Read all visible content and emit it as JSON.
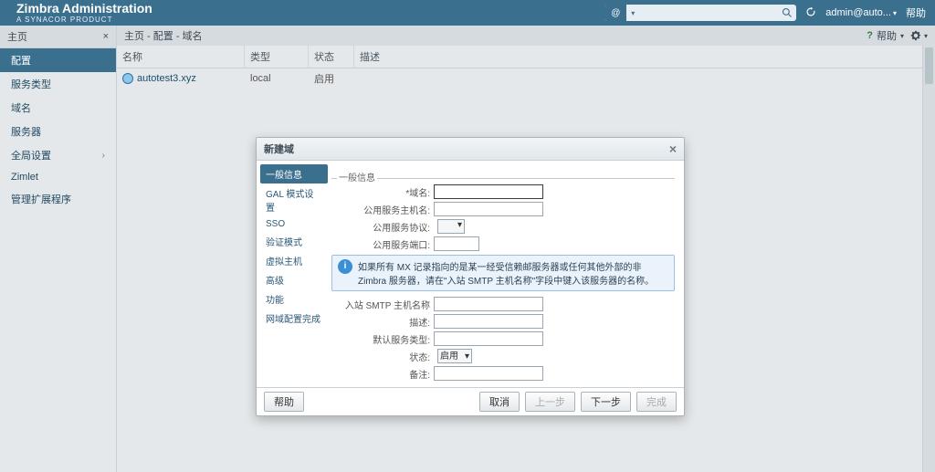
{
  "header": {
    "title": "Zimbra Administration",
    "subtitle": "A SYNACOR PRODUCT",
    "search_category_icon": "@",
    "search_placeholder": "",
    "user_label": "admin@auto...",
    "help_label": "帮助"
  },
  "left_nav": {
    "tab_title": "主页",
    "items": [
      {
        "label": "配置",
        "selected": true
      },
      {
        "label": "服务类型"
      },
      {
        "label": "域名"
      },
      {
        "label": "服务器"
      },
      {
        "label": "全局设置",
        "expandable": true
      },
      {
        "label": "Zimlet"
      },
      {
        "label": "管理扩展程序"
      }
    ]
  },
  "breadcrumb": "主页 - 配置 - 域名",
  "toolbar_help_label": "帮助",
  "table": {
    "columns": [
      "名称",
      "类型",
      "状态",
      "描述"
    ],
    "rows": [
      {
        "name": "autotest3.xyz",
        "type": "local",
        "status": "启用",
        "desc": ""
      }
    ]
  },
  "dialog": {
    "title": "新建域",
    "nav": [
      "一般信息",
      "GAL 模式设置",
      "SSO",
      "验证模式",
      "虚拟主机",
      "高级",
      "功能",
      "网域配置完成"
    ],
    "fieldset_label": "一般信息",
    "labels": {
      "domain_name": "域名:",
      "public_host": "公用服务主机名:",
      "public_proto": "公用服务协议:",
      "public_port": "公用服务端口:",
      "inbound_smtp": "入站 SMTP 主机名称",
      "desc": "描述:",
      "default_cos": "默认服务类型:",
      "status": "状态:",
      "note": "备注:"
    },
    "info_text": "如果所有 MX 记录指向的是某一经受信赖邮服务器或任何其他外部的非 Zimbra 服务器，请在\"入站 SMTP 主机名称\"字段中键入该服务器的名称。",
    "status_value": "启用",
    "footer": {
      "help": "帮助",
      "cancel": "取消",
      "prev": "上一步",
      "next": "下一步",
      "finish": "完成"
    }
  }
}
